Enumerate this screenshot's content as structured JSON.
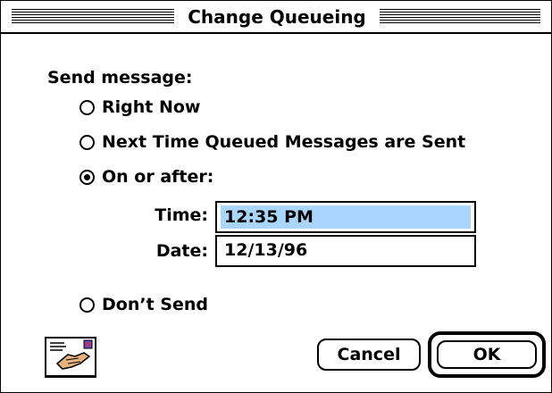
{
  "window": {
    "title": "Change Queueing"
  },
  "form": {
    "send_label": "Send message:",
    "options": [
      {
        "label": "Right Now",
        "checked": false
      },
      {
        "label": "Next Time Queued Messages are Sent",
        "checked": false
      },
      {
        "label": "On or after:",
        "checked": true
      },
      {
        "label": "Don’t Send",
        "checked": false
      }
    ],
    "time": {
      "label": "Time:",
      "value": "12:35 PM"
    },
    "date": {
      "label": "Date:",
      "value": "12/13/96"
    }
  },
  "buttons": {
    "cancel": "Cancel",
    "ok": "OK"
  },
  "icons": {
    "mail": "envelope-hand-icon"
  },
  "colors": {
    "selection": "#a9d5ff"
  }
}
